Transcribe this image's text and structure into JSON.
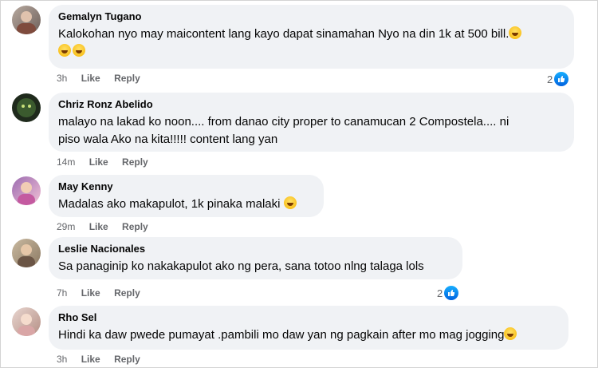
{
  "comments": [
    {
      "name": "Gemalyn Tugano",
      "text1": "Kalokohan nyo may maicontent lang kayo dapat sinamahan Nyo na din 1k at 500 bill.",
      "text2": "",
      "time": "3h",
      "like": "Like",
      "reply": "Reply",
      "reactions": "2"
    },
    {
      "name": "Chriz Ronz Abelido",
      "text1": "malayo na lakad ko noon.... from danao city proper to canamucan 2 Compostela.... ni",
      "text2": "piso wala Ako na kita!!!!! content lang yan",
      "time": "14m",
      "like": "Like",
      "reply": "Reply",
      "reactions": ""
    },
    {
      "name": "May Kenny",
      "text1": "Madalas ako makapulot, 1k pinaka malaki",
      "text2": "",
      "time": "29m",
      "like": "Like",
      "reply": "Reply",
      "reactions": ""
    },
    {
      "name": "Leslie Nacionales",
      "text1": "Sa panaginip ko nakakapulot ako ng pera, sana totoo nlng talaga lols",
      "text2": "",
      "time": "7h",
      "like": "Like",
      "reply": "Reply",
      "reactions": "2"
    },
    {
      "name": "Rho Sel",
      "text1": "Hindi ka daw pwede pumayat .pambili mo daw yan ng pagkain after mo mag jogging",
      "text2": "",
      "time": "3h",
      "like": "Like",
      "reply": "Reply",
      "reactions": ""
    }
  ],
  "colors": {
    "bubble": "#f0f2f5",
    "meta": "#65676b",
    "like_blue": "#1877f2"
  },
  "icons": [
    "laughing-emoji-icon",
    "grin-emoji-icon",
    "like-reaction-icon"
  ]
}
